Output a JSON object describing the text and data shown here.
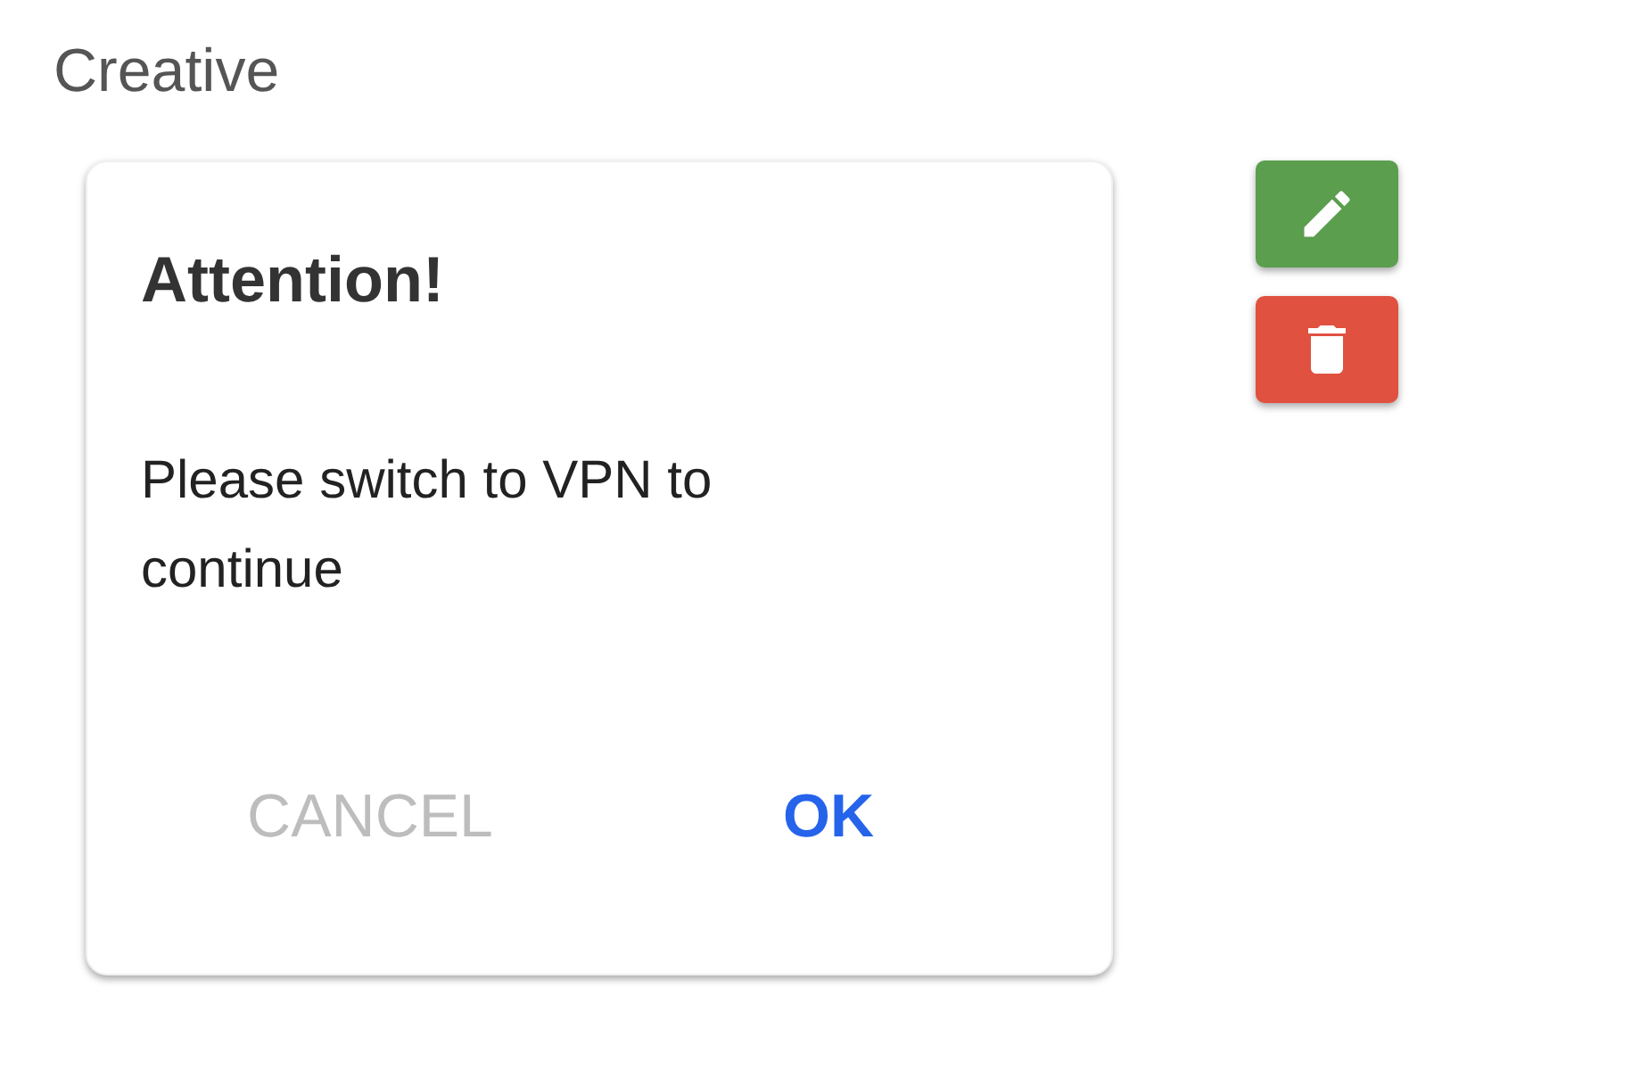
{
  "section": {
    "title": "Creative"
  },
  "dialog": {
    "title": "Attention!",
    "message": "Please switch to VPN to continue",
    "buttons": [
      {
        "label": "CANCEL",
        "kind": "secondary"
      },
      {
        "label": "OK",
        "kind": "primary"
      }
    ]
  },
  "actions": [
    {
      "kind": "edit",
      "color": "#5a9e4e"
    },
    {
      "kind": "delete",
      "color": "#e05140"
    }
  ]
}
